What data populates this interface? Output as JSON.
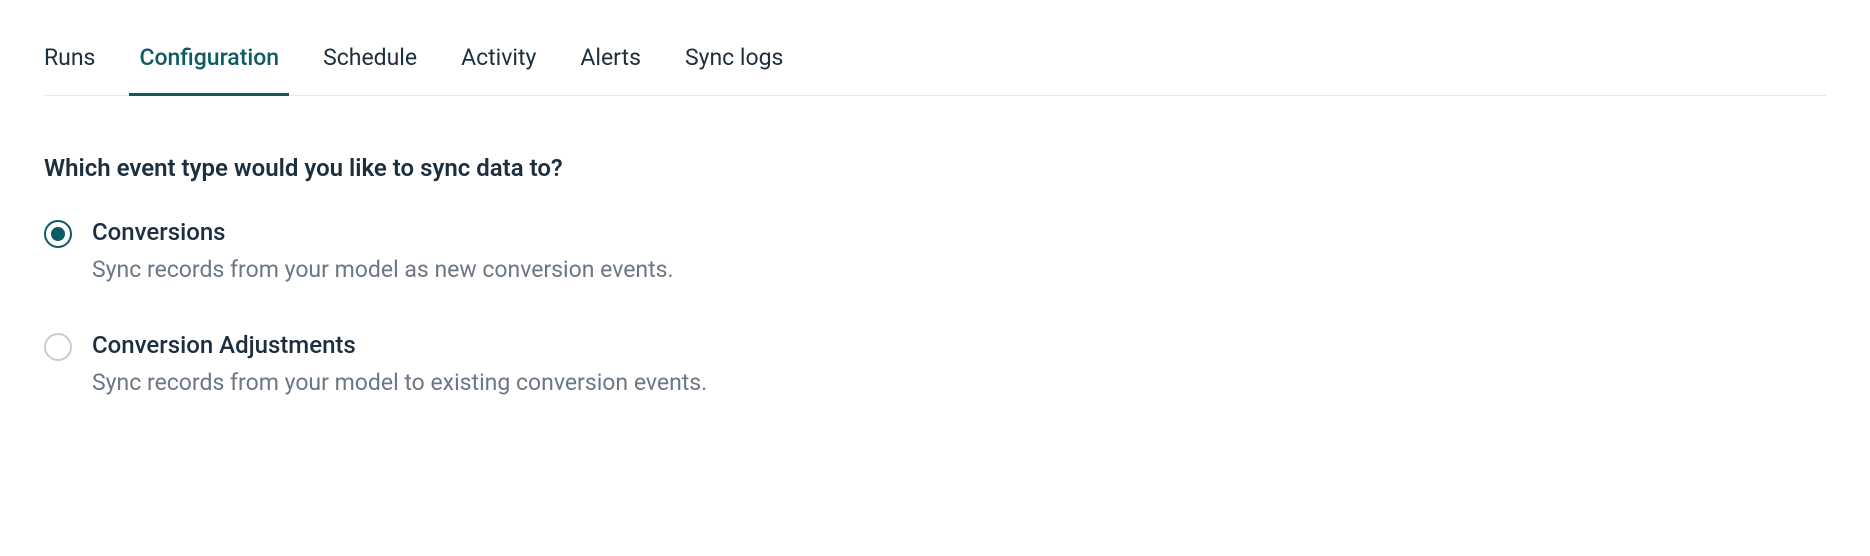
{
  "tabs": [
    {
      "label": "Runs",
      "active": false
    },
    {
      "label": "Configuration",
      "active": true
    },
    {
      "label": "Schedule",
      "active": false
    },
    {
      "label": "Activity",
      "active": false
    },
    {
      "label": "Alerts",
      "active": false
    },
    {
      "label": "Sync logs",
      "active": false
    }
  ],
  "question": "Which event type would you like to sync data to?",
  "options": [
    {
      "title": "Conversions",
      "description": "Sync records from your model as new conversion events.",
      "selected": true
    },
    {
      "title": "Conversion Adjustments",
      "description": "Sync records from your model to existing conversion events.",
      "selected": false
    }
  ]
}
